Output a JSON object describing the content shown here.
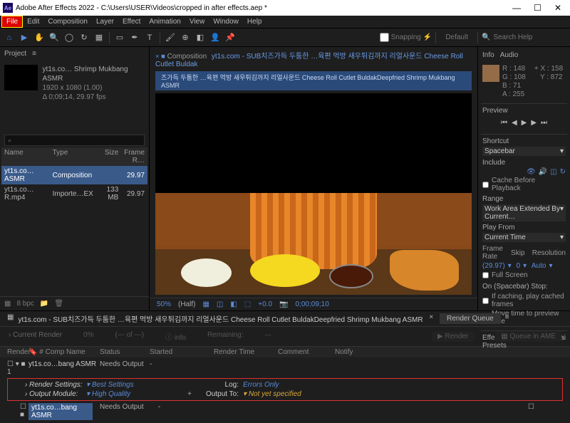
{
  "titlebar": {
    "app": "Adobe After Effects 2022",
    "path": "C:\\Users\\USER\\Videos\\cropped in after effects.aep *"
  },
  "menu": [
    "File",
    "Edit",
    "Composition",
    "Layer",
    "Effect",
    "Animation",
    "View",
    "Window",
    "Help"
  ],
  "toolbar": {
    "snapping": "Snapping",
    "default": "Default",
    "search": "Search Help"
  },
  "project": {
    "tab": "Project",
    "item_name": "yt1s.co… Shrimp Mukbang ASMR",
    "dims": "1920 x 1080 (1.00)",
    "dur": "Δ 0;09;14, 29.97 fps",
    "cols": [
      "Name",
      "Type",
      "Size",
      "Frame R…"
    ],
    "rows": [
      {
        "name": "yt1s.co…ASMR",
        "type": "Composition",
        "size": "",
        "fr": "29.97"
      },
      {
        "name": "yt1s.co…R.mp4",
        "type": "Importe…EX",
        "size": "133 MB",
        "fr": "29.97"
      }
    ],
    "footer_bpc": "8 bpc"
  },
  "comp": {
    "crumb_label": "Composition",
    "crumb1": "yt1s.com - SUB치즈가득 두툼한 …육편 먹방 새우튀김까지 리얼사운드 Cheese Roll Cutlet Buldak",
    "sub": "즈가득 두툼한 …육편 먹방 새우튀김까지 리얼사운드 Cheese Roll Cutlet BuldakDeepfried Shrimp Mukbang ASMR",
    "zoom": "50%",
    "half": "(Half)",
    "tc": "0;00;09;10",
    "plus": "+0.0"
  },
  "right": {
    "tabs": [
      "Info",
      "Audio"
    ],
    "rgba": {
      "r": "R : 148",
      "g": "G : 108",
      "b": "B : 71",
      "a": "A : 255"
    },
    "xy": {
      "x": "X : 158",
      "y": "Y : 872"
    },
    "preview": "Preview",
    "shortcut_lbl": "Shortcut",
    "shortcut": "Spacebar",
    "include_lbl": "Include",
    "cache": "Cache Before Playback",
    "range_lbl": "Range",
    "range": "Work Area Extended By Current…",
    "playfrom_lbl": "Play From",
    "playfrom": "Current Time",
    "fr_lbl": "Frame Rate",
    "skip_lbl": "Skip",
    "res_lbl": "Resolution",
    "fr": "(29.97)",
    "skip": "0",
    "res": "Auto",
    "fullscreen": "Full Screen",
    "onstop": "On (Spacebar) Stop:",
    "ifcache": "If caching, play cached frames",
    "movetime": "Move time to preview time",
    "fx": "Effects & Presets",
    "lib": "Librai"
  },
  "rq": {
    "comp": "yt1s.com - SUB치즈가득 두툼한 …육편 먹방 새우튀김까지 리얼사운드 Cheese Roll Cutlet BuldakDeepfried Shrimp Mukbang ASMR",
    "tab": "Render Queue",
    "current": "Current Render",
    "pct": "0%",
    "of": "(--- of ---)",
    "info": "info",
    "remaining": "Remaining:",
    "render_btn": "Render",
    "queue_btn": "Queue in AME",
    "cols": [
      "Render",
      "Comp Name",
      "Status",
      "Started",
      "Render Time",
      "Comment",
      "Notify"
    ],
    "row1_name": "yt1s.co…bang ASMR",
    "row1_status": "Needs Output",
    "rs_lbl": "Render Settings:",
    "rs_val": "Best Settings",
    "log_lbl": "Log:",
    "log_val": "Errors Only",
    "om_lbl": "Output Module:",
    "om_val": "High Quality",
    "out_lbl": "Output To:",
    "out_val": "Not yet specified",
    "row2_name": "yt1s.co…bang ASMR",
    "row2_status": "Needs Output"
  }
}
